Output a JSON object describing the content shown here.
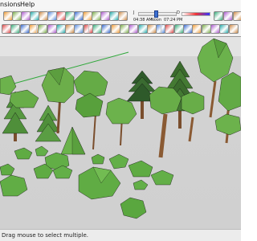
{
  "menu": {
    "items": [
      "nsions",
      "Help"
    ]
  },
  "shadows": {
    "time_start": "04:38 AM",
    "time_noon": "Noon",
    "time_end": "07:24 PM",
    "date_month_start": "J",
    "date_month_end": "D"
  },
  "status": {
    "hint": "Drag mouse to select multiple."
  },
  "colors": {
    "canopy": "#5fa844",
    "canopy_dark": "#3d7a2a",
    "trunk": "#8a5a33",
    "rock": "#5fae45",
    "axis_green": "#2fa83a"
  },
  "toolbar_icons": [
    "select-icon",
    "eraser-icon",
    "paint-bucket-icon",
    "line-icon",
    "arc-icon",
    "rectangle-icon",
    "push-pull-icon",
    "move-icon",
    "rotate-icon",
    "scale-icon",
    "offset-icon",
    "tape-measure-icon",
    "text-icon",
    "orbit-icon",
    "pan-icon",
    "zoom-icon",
    "zoom-extents-icon",
    "components-icon"
  ]
}
